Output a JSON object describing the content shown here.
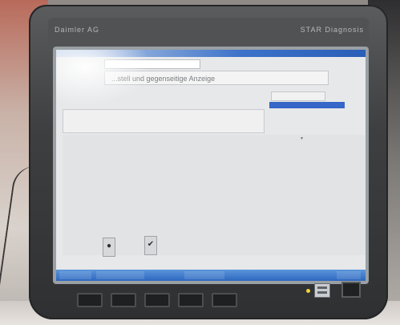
{
  "device": {
    "brand_left": "Daimler AG",
    "brand_right": "STAR Diagnosis"
  },
  "window": {
    "title_left": "",
    "title_mid": "",
    "title_right": ""
  },
  "header": {
    "field1": "",
    "field2_label": "",
    "field2_value": "",
    "subtitle": "...stell und gegenseitige Anzeige"
  },
  "right_column": {
    "header": "",
    "selected_item": ""
  },
  "main": {
    "section_label": "",
    "info_line_1": "",
    "info_line_2": ""
  },
  "fkeys": {
    "f1_icon": "pointer-icon",
    "f2_icon": "checkmark-icon"
  },
  "statusbar": {
    "item1": "",
    "item2": "",
    "item3": "",
    "item4": ""
  }
}
